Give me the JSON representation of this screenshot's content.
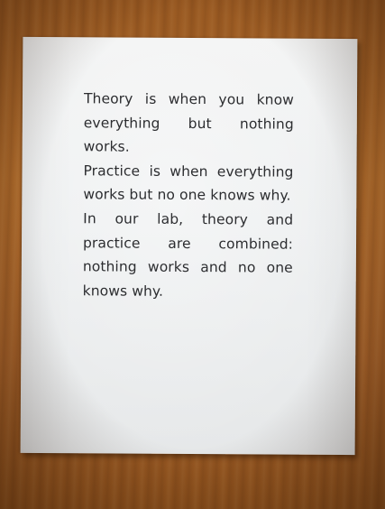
{
  "note": {
    "paragraphs": [
      "Theory is when you know everything but nothing works.",
      "Practice is when everything works but no one knows why.",
      "In our lab, theory and practice are combined: nothing works and no one knows why."
    ]
  },
  "colors": {
    "wood": "#a6622a",
    "paper": "#eef0f1",
    "ink": "#2c2d30"
  }
}
